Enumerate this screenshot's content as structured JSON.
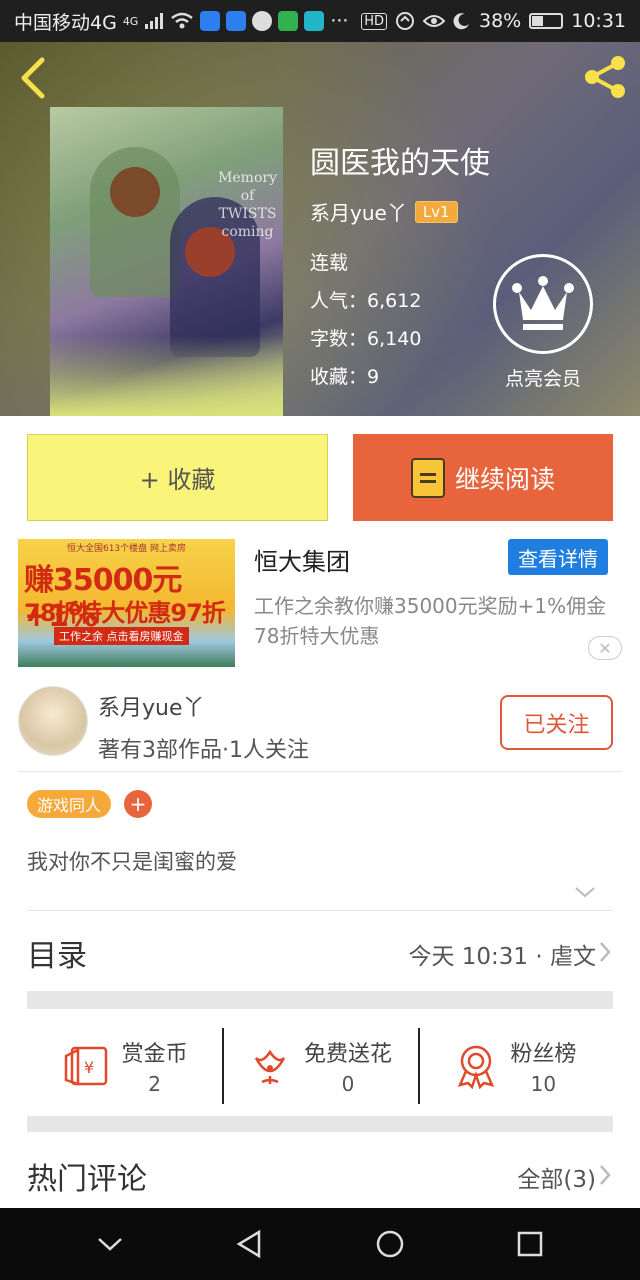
{
  "status_bar": {
    "carrier": "中国移动4G",
    "network_sup": "4G",
    "battery": "38%",
    "battery_level": 0.38,
    "time": "10:31",
    "hd": "HD",
    "more": "···"
  },
  "book": {
    "title": "圆医我的天使",
    "author": "系月yue丫",
    "level": "Lv1",
    "status": "连载",
    "popularity_label": "人气：",
    "popularity": "6,612",
    "words_label": "字数：",
    "words": "6,140",
    "favorites_label": "收藏：",
    "favorites": "9",
    "vip_label": "点亮会员",
    "cover_text": [
      "Memory",
      "of",
      "TWISTS",
      "coming"
    ]
  },
  "actions": {
    "collect": "+ 收藏",
    "read": "继续阅读"
  },
  "ad": {
    "title": "恒大集团",
    "detail_button": "查看详情",
    "desc": "工作之余教你赚35000元奖励+1%佣金 78折特大优惠",
    "close": "✕",
    "img_t1": "恒大全国613个楼盘 网上卖房",
    "img_t2": "赚35000元+1%",
    "img_t3": "78折特大优惠97折",
    "img_t4": "工作之余 点击看房赚现金"
  },
  "author_card": {
    "name": "系月yue丫",
    "info": "著有3部作品·1人关注",
    "follow": "已关注"
  },
  "tags": {
    "tag1": "游戏同人",
    "add": "+"
  },
  "intro": "我对你不只是闺蜜的爱",
  "toc": {
    "label": "目录",
    "info": "今天 10:31 · 虐文"
  },
  "stats": [
    {
      "label": "赏金币",
      "value": "2",
      "icon": "coin-envelope-icon"
    },
    {
      "label": "免费送花",
      "value": "0",
      "icon": "flower-icon"
    },
    {
      "label": "粉丝榜",
      "value": "10",
      "icon": "medal-icon"
    }
  ],
  "hot_comments": {
    "label": "热门评论",
    "all": "全部(3)"
  },
  "colors": {
    "accent_orange": "#e8643c",
    "collect_yellow": "#fbf47a",
    "ad_blue": "#1f7ee0",
    "level_badge": "#f3a93b"
  }
}
